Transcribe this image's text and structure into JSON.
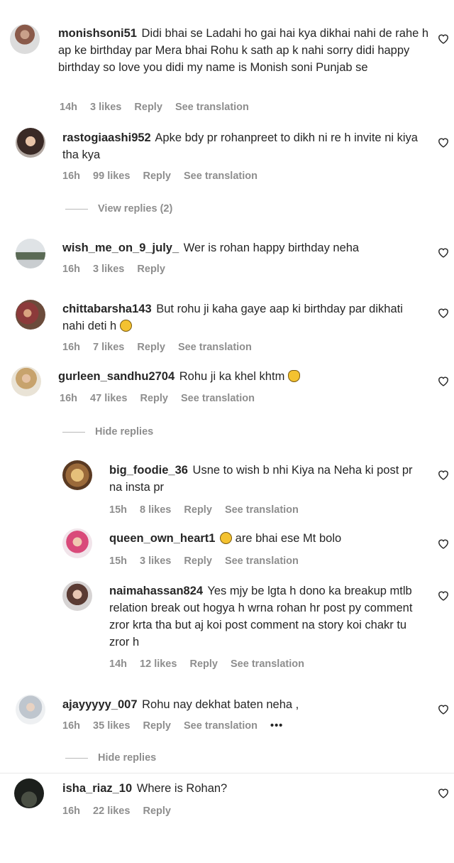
{
  "comments": [
    {
      "user": "monishsoni51",
      "text": "Didi bhai se Ladahi ho gai hai kya dikhai nahi de rahe h ap ke birthday par Mera bhai Rohu k sath ap k nahi sorry didi happy birthday so love you didi my name is Monish soni Punjab se",
      "time": "14h",
      "likes": "3 likes",
      "reply": "Reply",
      "translate": "See translation"
    },
    {
      "user": "rastogiaashi952",
      "text": "Apke bdy pr rohanpreet to dikh ni re h invite ni kiya tha kya",
      "time": "16h",
      "likes": "99 likes",
      "reply": "Reply",
      "translate": "See translation",
      "toggle": "View replies (2)"
    },
    {
      "user": "wish_me_on_9_july_",
      "text": "Wer is rohan happy birthday neha",
      "time": "16h",
      "likes": "3 likes",
      "reply": "Reply"
    },
    {
      "user": "chittabarsha143",
      "text": "But rohu ji kaha gaye aap ki birthday par dikhati nahi deti h",
      "time": "16h",
      "likes": "7 likes",
      "reply": "Reply",
      "translate": "See translation"
    },
    {
      "user": "gurleen_sandhu2704",
      "text": "Rohu ji ka khel khtm",
      "time": "16h",
      "likes": "47 likes",
      "reply": "Reply",
      "translate": "See translation",
      "toggle": "Hide replies"
    },
    {
      "user": "big_foodie_36",
      "text": "Usne to wish b nhi Kiya na Neha ki post pr na insta pr",
      "time": "15h",
      "likes": "8 likes",
      "reply": "Reply",
      "translate": "See translation"
    },
    {
      "user": "queen_own_heart1",
      "text": "are bhai ese Mt bolo",
      "time": "15h",
      "likes": "3 likes",
      "reply": "Reply",
      "translate": "See translation"
    },
    {
      "user": "naimahassan824",
      "text": "Yes mjy be lgta h dono ka breakup mtlb relation break out hogya h wrna rohan hr post py comment zror krta tha but aj koi post comment na story koi chakr tu zror h",
      "time": "14h",
      "likes": "12 likes",
      "reply": "Reply",
      "translate": "See translation"
    },
    {
      "user": "ajayyyyy_007",
      "text": "Rohu nay dekhat baten neha ,",
      "time": "16h",
      "likes": "35 likes",
      "reply": "Reply",
      "translate": "See translation",
      "more": "•••",
      "toggle": "Hide replies"
    },
    {
      "user": "isha_riaz_10",
      "text": "Where is Rohan?",
      "time": "16h",
      "likes": "22 likes",
      "reply": "Reply"
    }
  ],
  "colors": {
    "text": "#262626",
    "meta": "#8e8e8e"
  },
  "icons": {
    "like": "heart-outline-icon",
    "emoji_sad": "sad-face-emoji",
    "emoji_clap": "clapping-hands-emoji",
    "emoji_cry": "crying-face-emoji"
  }
}
